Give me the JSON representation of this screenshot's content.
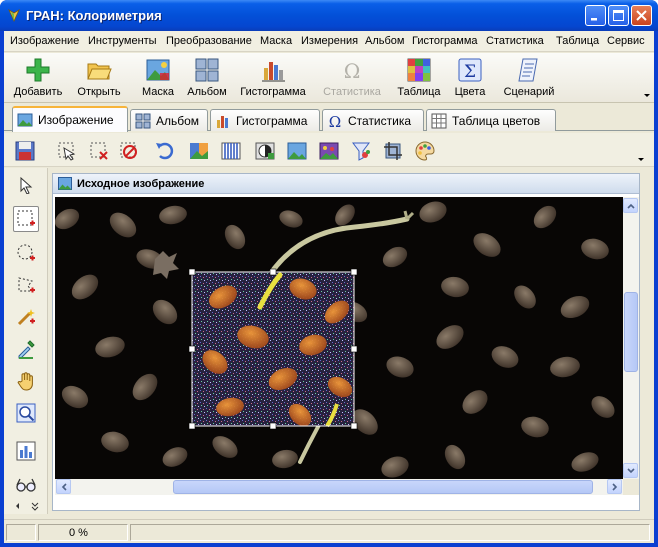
{
  "window": {
    "title": "ГРАН: Колориметрия"
  },
  "menu": [
    "Изображение",
    "Инструменты",
    "Преобразование",
    "Маска",
    "Измерения",
    "Альбом",
    "Гистограмма",
    "Статистика",
    "Таблица",
    "Сервис"
  ],
  "toolbar": [
    {
      "label": "Добавить",
      "icon": "add-plus-icon",
      "enabled": true
    },
    {
      "label": "Открыть",
      "icon": "open-folder-icon",
      "enabled": true
    },
    {
      "label": "Маска",
      "icon": "mask-image-icon",
      "enabled": true
    },
    {
      "label": "Альбом",
      "icon": "album-grid-icon",
      "enabled": true
    },
    {
      "label": "Гистограмма",
      "icon": "histogram-icon",
      "enabled": true
    },
    {
      "label": "Статистика",
      "icon": "omega-icon",
      "enabled": false
    },
    {
      "label": "Таблица",
      "icon": "table-icon",
      "enabled": true
    },
    {
      "label": "Цвета",
      "icon": "sigma-icon",
      "enabled": true
    },
    {
      "label": "Сценарий",
      "icon": "script-scroll-icon",
      "enabled": true
    }
  ],
  "tabs": [
    {
      "label": "Изображение",
      "icon": "image-icon",
      "active": true
    },
    {
      "label": "Альбом",
      "icon": "album-icon",
      "active": false
    },
    {
      "label": "Гистограмма",
      "icon": "histogram-icon",
      "active": false
    },
    {
      "label": "Статистика",
      "icon": "omega-icon",
      "active": false
    },
    {
      "label": "Таблица цветов",
      "icon": "color-table-icon",
      "active": false
    }
  ],
  "panel": {
    "title": "Исходное изображение"
  },
  "status": {
    "progress": "0 %"
  },
  "colors": {
    "titlebar": "#0350d8",
    "selection": "#ffffff",
    "tab_highlight": "#f7b43a"
  }
}
